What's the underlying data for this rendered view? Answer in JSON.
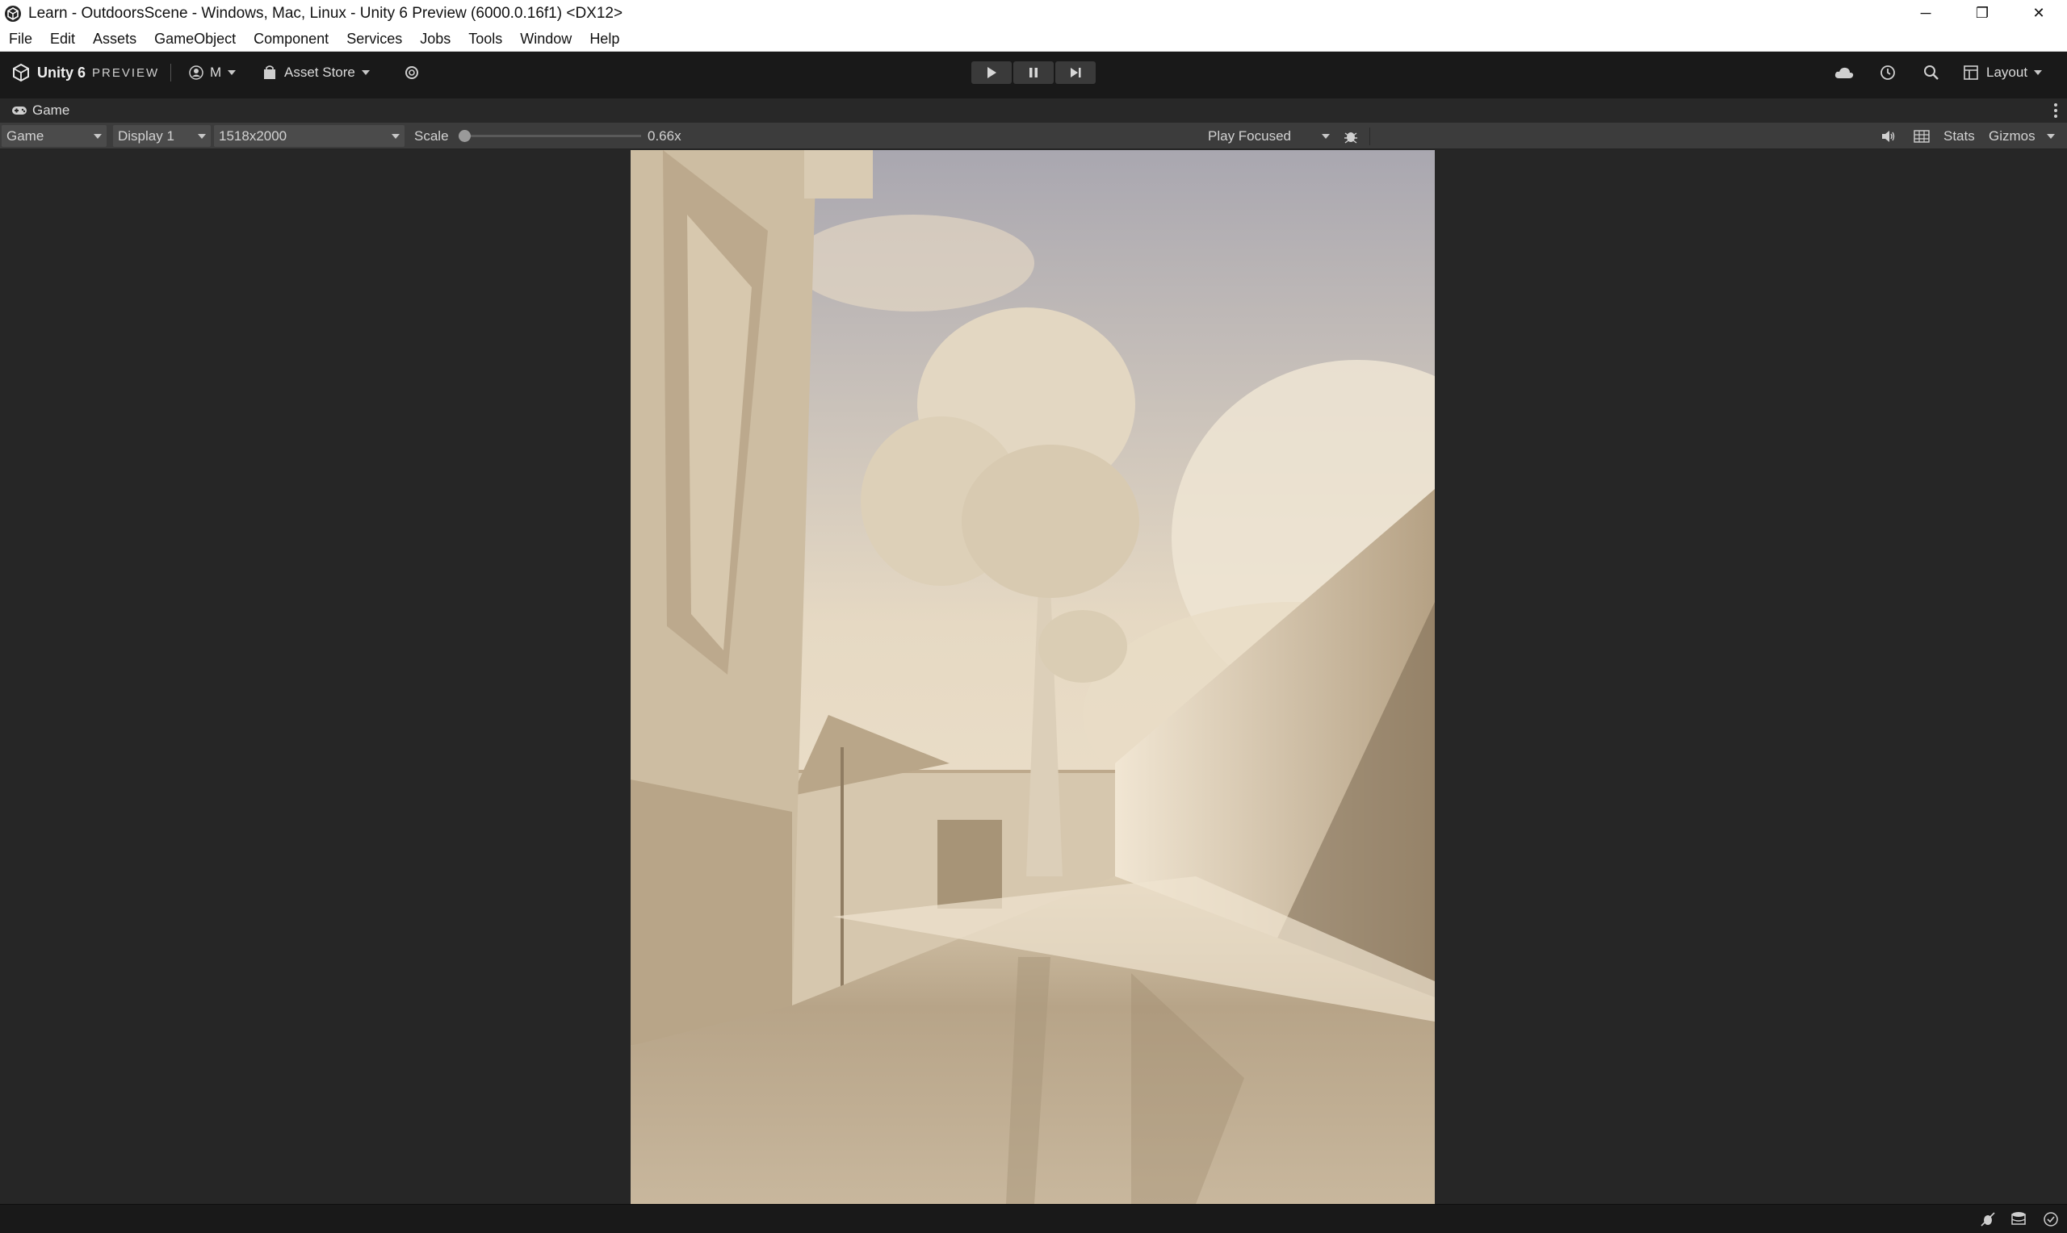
{
  "window": {
    "title": "Learn - OutdoorsScene - Windows, Mac, Linux - Unity 6 Preview (6000.0.16f1) <DX12>",
    "controls": [
      "─",
      "❐",
      "✕"
    ]
  },
  "menubar": {
    "items": [
      "File",
      "Edit",
      "Assets",
      "GameObject",
      "Component",
      "Services",
      "Jobs",
      "Tools",
      "Window",
      "Help"
    ]
  },
  "toolbar": {
    "brand": "Unity 6",
    "brand_badge": "PREVIEW",
    "account": "M",
    "asset_store": "Asset Store",
    "layout": "Layout"
  },
  "game_tab": {
    "label": "Game"
  },
  "game_toolbar": {
    "view_mode": "Game",
    "display": "Display 1",
    "resolution": "1518x2000",
    "scale_label": "Scale",
    "scale_value": "0.66x",
    "scale_fraction": 0.0,
    "play_mode": "Play Focused",
    "stats": "Stats",
    "gizmos": "Gizmos"
  },
  "colors": {
    "titlebar_bg": "#ffffff",
    "toolbar_bg": "#191919",
    "panel_bg": "#262626",
    "game_toolbar_bg": "#3c3c3c",
    "scene_tint": "#cdbba2"
  }
}
